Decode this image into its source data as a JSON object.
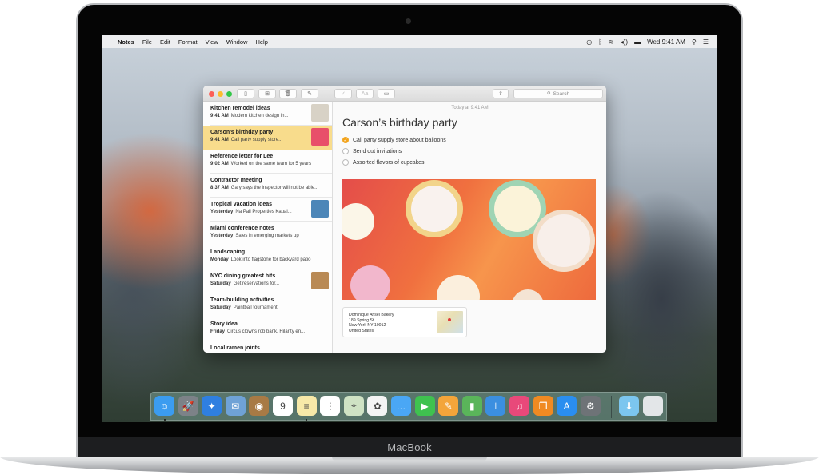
{
  "device": {
    "label": "MacBook"
  },
  "menubar": {
    "app": "Notes",
    "items": [
      "File",
      "Edit",
      "Format",
      "View",
      "Window",
      "Help"
    ],
    "clock": "Wed 9:41 AM",
    "icons": [
      "time-machine-icon",
      "bluetooth-icon",
      "wifi-icon",
      "volume-icon",
      "battery-icon",
      "spotlight-icon",
      "notification-center-icon"
    ]
  },
  "toolbar": {
    "buttons": [
      "sidebar-toggle",
      "attachments-browser",
      "delete",
      "compose",
      "checklist",
      "format",
      "table"
    ],
    "share": "share",
    "search_placeholder": "Search"
  },
  "notes": [
    {
      "title": "Kitchen remodel ideas",
      "date": "9:41 AM",
      "snippet": "Modern kitchen design in...",
      "thumb": true,
      "thumb_color": "#d8d2c6"
    },
    {
      "title": "Carson’s birthday party",
      "date": "9:41 AM",
      "snippet": "Call party supply store...",
      "thumb": true,
      "thumb_color": "#e8506a",
      "selected": true
    },
    {
      "title": "Reference letter for Lee",
      "date": "9:02 AM",
      "snippet": "Worked on the same team for 5 years"
    },
    {
      "title": "Contractor meeting",
      "date": "8:37 AM",
      "snippet": "Gary says the inspector will not be able..."
    },
    {
      "title": "Tropical vacation ideas",
      "date": "Yesterday",
      "snippet": "Na Pali Properties Kauai...",
      "thumb": true,
      "thumb_color": "#4c86b8"
    },
    {
      "title": "Miami conference notes",
      "date": "Yesterday",
      "snippet": "Sales in emerging markets up"
    },
    {
      "title": "Landscaping",
      "date": "Monday",
      "snippet": "Look into flagstone for backyard patio"
    },
    {
      "title": "NYC dining greatest hits",
      "date": "Saturday",
      "snippet": "Get reservations for...",
      "thumb": true,
      "thumb_color": "#b98a55"
    },
    {
      "title": "Team-building activities",
      "date": "Saturday",
      "snippet": "Paintball tournament"
    },
    {
      "title": "Story idea",
      "date": "Friday",
      "snippet": "Circus clowns rob bank. Hilarity en..."
    },
    {
      "title": "Local ramen joints",
      "date": "",
      "snippet": ""
    }
  ],
  "note": {
    "timestamp": "Today at 9:41 AM",
    "title": "Carson’s birthday party",
    "checklist": [
      {
        "text": "Call party supply store about balloons",
        "done": true
      },
      {
        "text": "Send out invitations",
        "done": false
      },
      {
        "text": "Assorted flavors of cupcakes",
        "done": false
      }
    ],
    "image": "cupcakes-photo",
    "address": {
      "lines": [
        "Dominique Ansel Bakery",
        "189 Spring St",
        "New York NY 10012",
        "United States"
      ]
    }
  },
  "dock": {
    "apps": [
      {
        "name": "Finder",
        "icon": "finder-icon",
        "color": "#3b9cf0",
        "glyph": "☺",
        "running": true
      },
      {
        "name": "Launchpad",
        "icon": "launchpad-icon",
        "color": "#7c8288",
        "glyph": "🚀"
      },
      {
        "name": "Safari",
        "icon": "safari-icon",
        "color": "#2f7fe0",
        "glyph": "✦"
      },
      {
        "name": "Mail",
        "icon": "mail-icon",
        "color": "#6fa2d6",
        "glyph": "✉"
      },
      {
        "name": "Contacts",
        "icon": "contacts-icon",
        "color": "#a87a45",
        "glyph": "◉"
      },
      {
        "name": "Calendar",
        "icon": "calendar-icon",
        "color": "#ffffff",
        "glyph": "9"
      },
      {
        "name": "Notes",
        "icon": "notes-icon",
        "color": "#f7e9a8",
        "glyph": "≡",
        "running": true
      },
      {
        "name": "Reminders",
        "icon": "reminders-icon",
        "color": "#ffffff",
        "glyph": "⋮"
      },
      {
        "name": "Maps",
        "icon": "maps-icon",
        "color": "#cfe2c4",
        "glyph": "⌖"
      },
      {
        "name": "Photos",
        "icon": "photos-icon",
        "color": "#f4f4f4",
        "glyph": "✿"
      },
      {
        "name": "Messages",
        "icon": "messages-icon",
        "color": "#4aa7f5",
        "glyph": "…"
      },
      {
        "name": "FaceTime",
        "icon": "facetime-icon",
        "color": "#3fc24f",
        "glyph": "▶"
      },
      {
        "name": "Pages",
        "icon": "pages-icon",
        "color": "#f3a53a",
        "glyph": "✎"
      },
      {
        "name": "Numbers",
        "icon": "numbers-icon",
        "color": "#5ab55a",
        "glyph": "▮"
      },
      {
        "name": "Keynote",
        "icon": "keynote-icon",
        "color": "#3b8fe0",
        "glyph": "⊥"
      },
      {
        "name": "iTunes",
        "icon": "itunes-icon",
        "color": "#e8497a",
        "glyph": "♫"
      },
      {
        "name": "iBooks",
        "icon": "ibooks-icon",
        "color": "#f08a22",
        "glyph": "❐"
      },
      {
        "name": "App Store",
        "icon": "app-store-icon",
        "color": "#2a8ef0",
        "glyph": "A"
      },
      {
        "name": "System Preferences",
        "icon": "system-preferences-icon",
        "color": "#6e7377",
        "glyph": "⚙"
      }
    ],
    "stacks": [
      {
        "name": "Downloads",
        "icon": "downloads-folder-icon",
        "color": "#7cc6ef",
        "glyph": "⬇"
      },
      {
        "name": "Trash",
        "icon": "trash-icon",
        "color": "#e3e6e8",
        "glyph": ""
      }
    ]
  },
  "colors": {
    "selection": "#f8dc8c",
    "check_done": "#f2a31b",
    "close": "#fc5f57",
    "minimize": "#fdbc2e",
    "zoom": "#33c748"
  }
}
